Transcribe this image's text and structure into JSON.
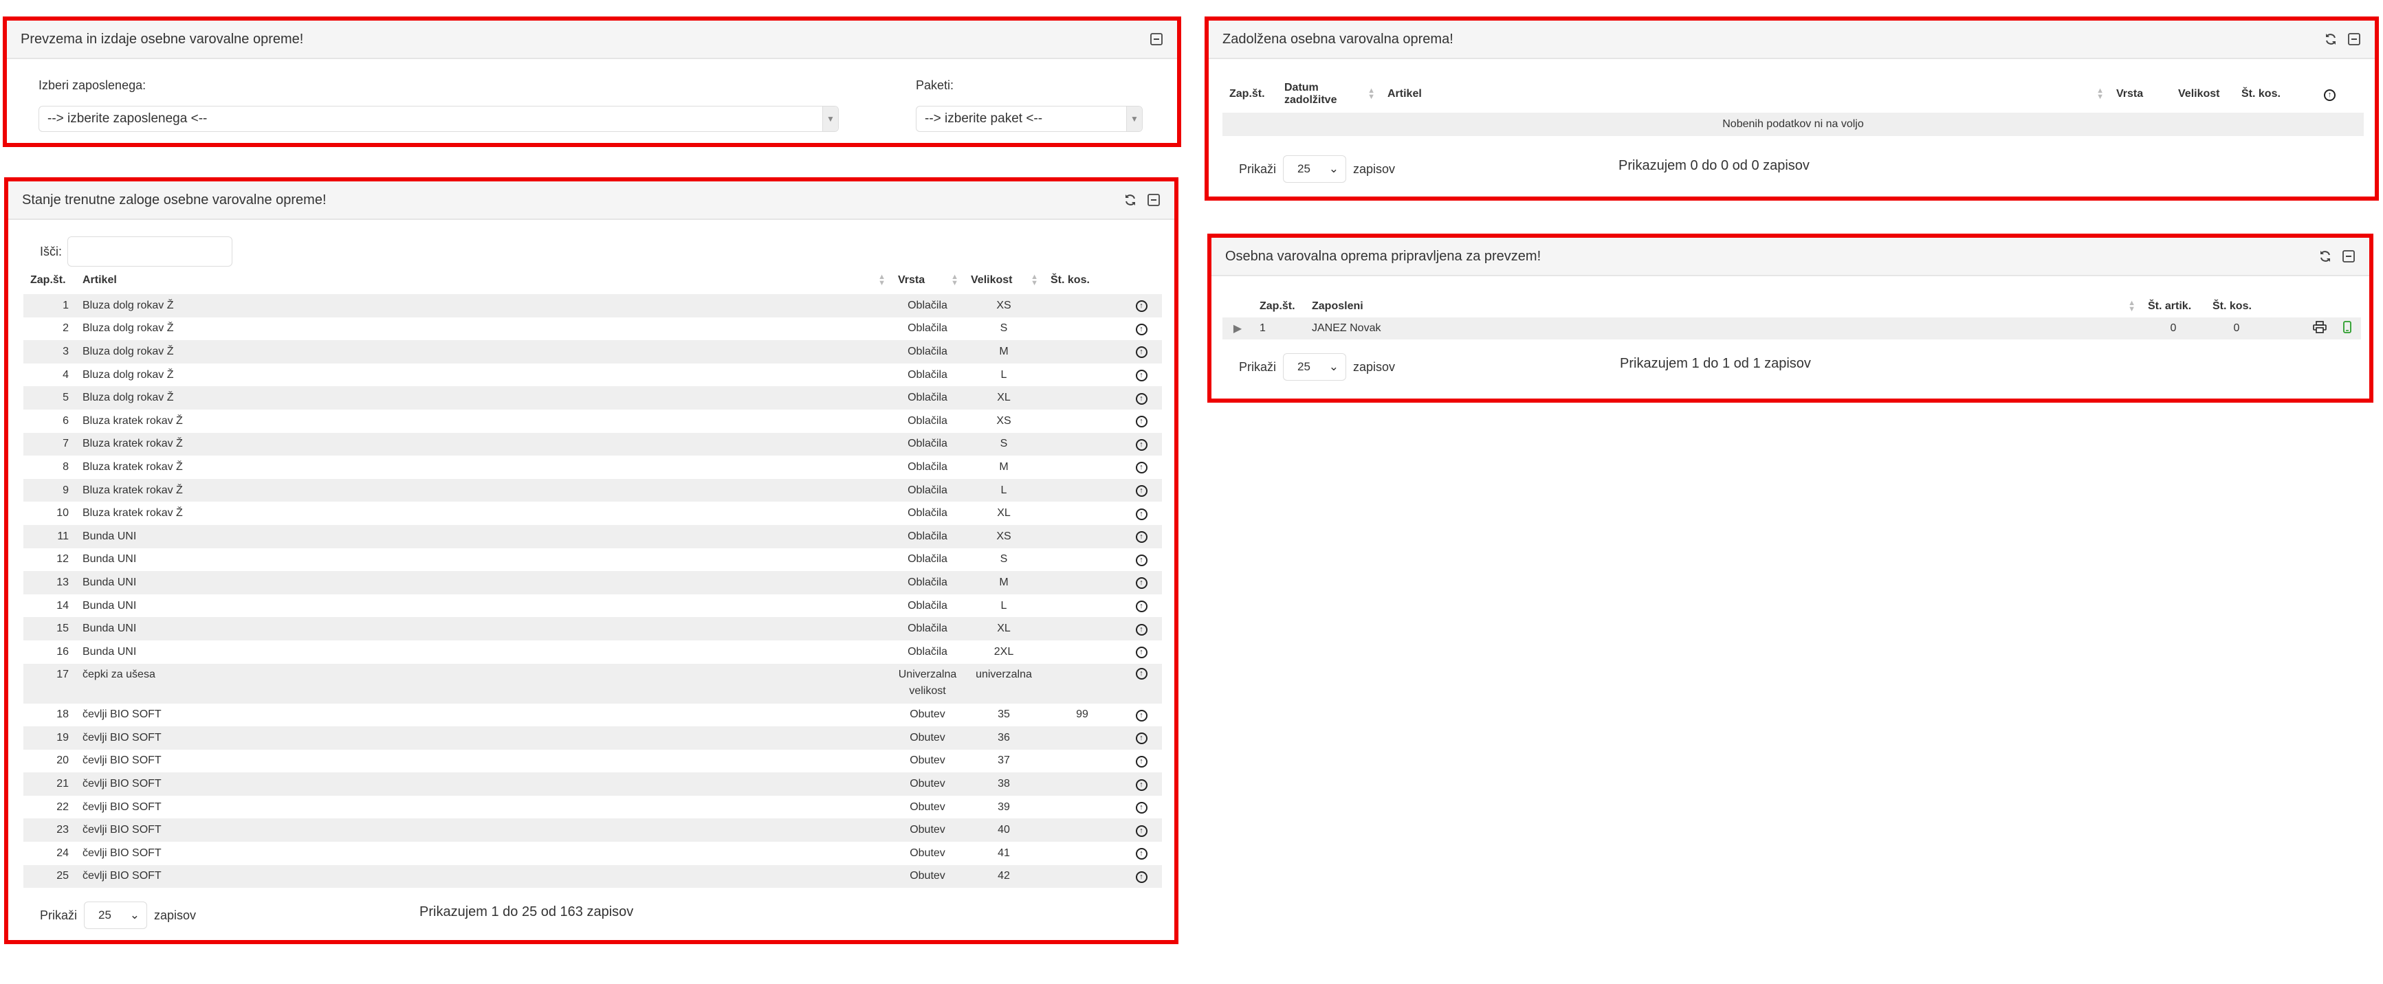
{
  "panel_issue": {
    "title": "Prevzema in izdaje osebne varovalne opreme!",
    "employee_label": "Izberi zaposlenega:",
    "employee_value": "--> izberite zaposlenega <--",
    "package_label": "Paketi:",
    "package_value": "--> izberite paket <--"
  },
  "panel_stock": {
    "title": "Stanje trenutne zaloge osebne varovalne opreme!",
    "search_label": "Išči:",
    "columns": [
      "Zap.št.",
      "Artikel",
      "Vrsta",
      "Velikost",
      "Št. kos."
    ],
    "rows": [
      {
        "n": "1",
        "artikel": "Bluza dolg rokav Ž",
        "vrsta": "Oblačila",
        "velikost": "XS",
        "kos": ""
      },
      {
        "n": "2",
        "artikel": "Bluza dolg rokav Ž",
        "vrsta": "Oblačila",
        "velikost": "S",
        "kos": ""
      },
      {
        "n": "3",
        "artikel": "Bluza dolg rokav Ž",
        "vrsta": "Oblačila",
        "velikost": "M",
        "kos": ""
      },
      {
        "n": "4",
        "artikel": "Bluza dolg rokav Ž",
        "vrsta": "Oblačila",
        "velikost": "L",
        "kos": ""
      },
      {
        "n": "5",
        "artikel": "Bluza dolg rokav Ž",
        "vrsta": "Oblačila",
        "velikost": "XL",
        "kos": ""
      },
      {
        "n": "6",
        "artikel": "Bluza kratek rokav Ž",
        "vrsta": "Oblačila",
        "velikost": "XS",
        "kos": ""
      },
      {
        "n": "7",
        "artikel": "Bluza kratek rokav Ž",
        "vrsta": "Oblačila",
        "velikost": "S",
        "kos": ""
      },
      {
        "n": "8",
        "artikel": "Bluza kratek rokav Ž",
        "vrsta": "Oblačila",
        "velikost": "M",
        "kos": ""
      },
      {
        "n": "9",
        "artikel": "Bluza kratek rokav Ž",
        "vrsta": "Oblačila",
        "velikost": "L",
        "kos": ""
      },
      {
        "n": "10",
        "artikel": "Bluza kratek rokav Ž",
        "vrsta": "Oblačila",
        "velikost": "XL",
        "kos": ""
      },
      {
        "n": "11",
        "artikel": "Bunda UNI",
        "vrsta": "Oblačila",
        "velikost": "XS",
        "kos": ""
      },
      {
        "n": "12",
        "artikel": "Bunda UNI",
        "vrsta": "Oblačila",
        "velikost": "S",
        "kos": ""
      },
      {
        "n": "13",
        "artikel": "Bunda UNI",
        "vrsta": "Oblačila",
        "velikost": "M",
        "kos": ""
      },
      {
        "n": "14",
        "artikel": "Bunda UNI",
        "vrsta": "Oblačila",
        "velikost": "L",
        "kos": ""
      },
      {
        "n": "15",
        "artikel": "Bunda UNI",
        "vrsta": "Oblačila",
        "velikost": "XL",
        "kos": ""
      },
      {
        "n": "16",
        "artikel": "Bunda UNI",
        "vrsta": "Oblačila",
        "velikost": "2XL",
        "kos": ""
      },
      {
        "n": "17",
        "artikel": "čepki za ušesa",
        "vrsta": "Univerzalna velikost",
        "velikost": "univerzalna",
        "kos": ""
      },
      {
        "n": "18",
        "artikel": "čevlji BIO SOFT",
        "vrsta": "Obutev",
        "velikost": "35",
        "kos": "99"
      },
      {
        "n": "19",
        "artikel": "čevlji BIO SOFT",
        "vrsta": "Obutev",
        "velikost": "36",
        "kos": ""
      },
      {
        "n": "20",
        "artikel": "čevlji BIO SOFT",
        "vrsta": "Obutev",
        "velikost": "37",
        "kos": ""
      },
      {
        "n": "21",
        "artikel": "čevlji BIO SOFT",
        "vrsta": "Obutev",
        "velikost": "38",
        "kos": ""
      },
      {
        "n": "22",
        "artikel": "čevlji BIO SOFT",
        "vrsta": "Obutev",
        "velikost": "39",
        "kos": ""
      },
      {
        "n": "23",
        "artikel": "čevlji BIO SOFT",
        "vrsta": "Obutev",
        "velikost": "40",
        "kos": ""
      },
      {
        "n": "24",
        "artikel": "čevlji BIO SOFT",
        "vrsta": "Obutev",
        "velikost": "41",
        "kos": ""
      },
      {
        "n": "25",
        "artikel": "čevlji BIO SOFT",
        "vrsta": "Obutev",
        "velikost": "42",
        "kos": ""
      }
    ],
    "length_prefix": "Prikaži",
    "length_value": "25",
    "length_suffix": "zapisov",
    "info": "Prikazujem 1 do 25 od 163 zapisov"
  },
  "panel_borrowed": {
    "title": "Zadolžena osebna varovalna oprema!",
    "columns": [
      "Zap.št.",
      "Datum zadolžitve",
      "Artikel",
      "Vrsta",
      "Velikost",
      "Št. kos."
    ],
    "empty_text": "Nobenih podatkov ni na voljo",
    "length_prefix": "Prikaži",
    "length_value": "25",
    "length_suffix": "zapisov",
    "info": "Prikazujem 0 do 0 od 0 zapisov"
  },
  "panel_prepared": {
    "title": "Osebna varovalna oprema pripravljena za prevzem!",
    "columns": [
      "Zap.št.",
      "Zaposleni",
      "Št. artik.",
      "Št. kos."
    ],
    "rows": [
      {
        "n": "1",
        "zaposleni": "JANEZ Novak",
        "artik": "0",
        "kos": "0"
      }
    ],
    "length_prefix": "Prikaži",
    "length_value": "25",
    "length_suffix": "zapisov",
    "info": "Prikazujem 1 do 1 od 1 zapisov"
  },
  "colors": {
    "panel_border": "#ee0000",
    "header_bg": "#f5f5f5",
    "odd_row": "#efefef",
    "mobile_icon": "#2a9d2a"
  }
}
